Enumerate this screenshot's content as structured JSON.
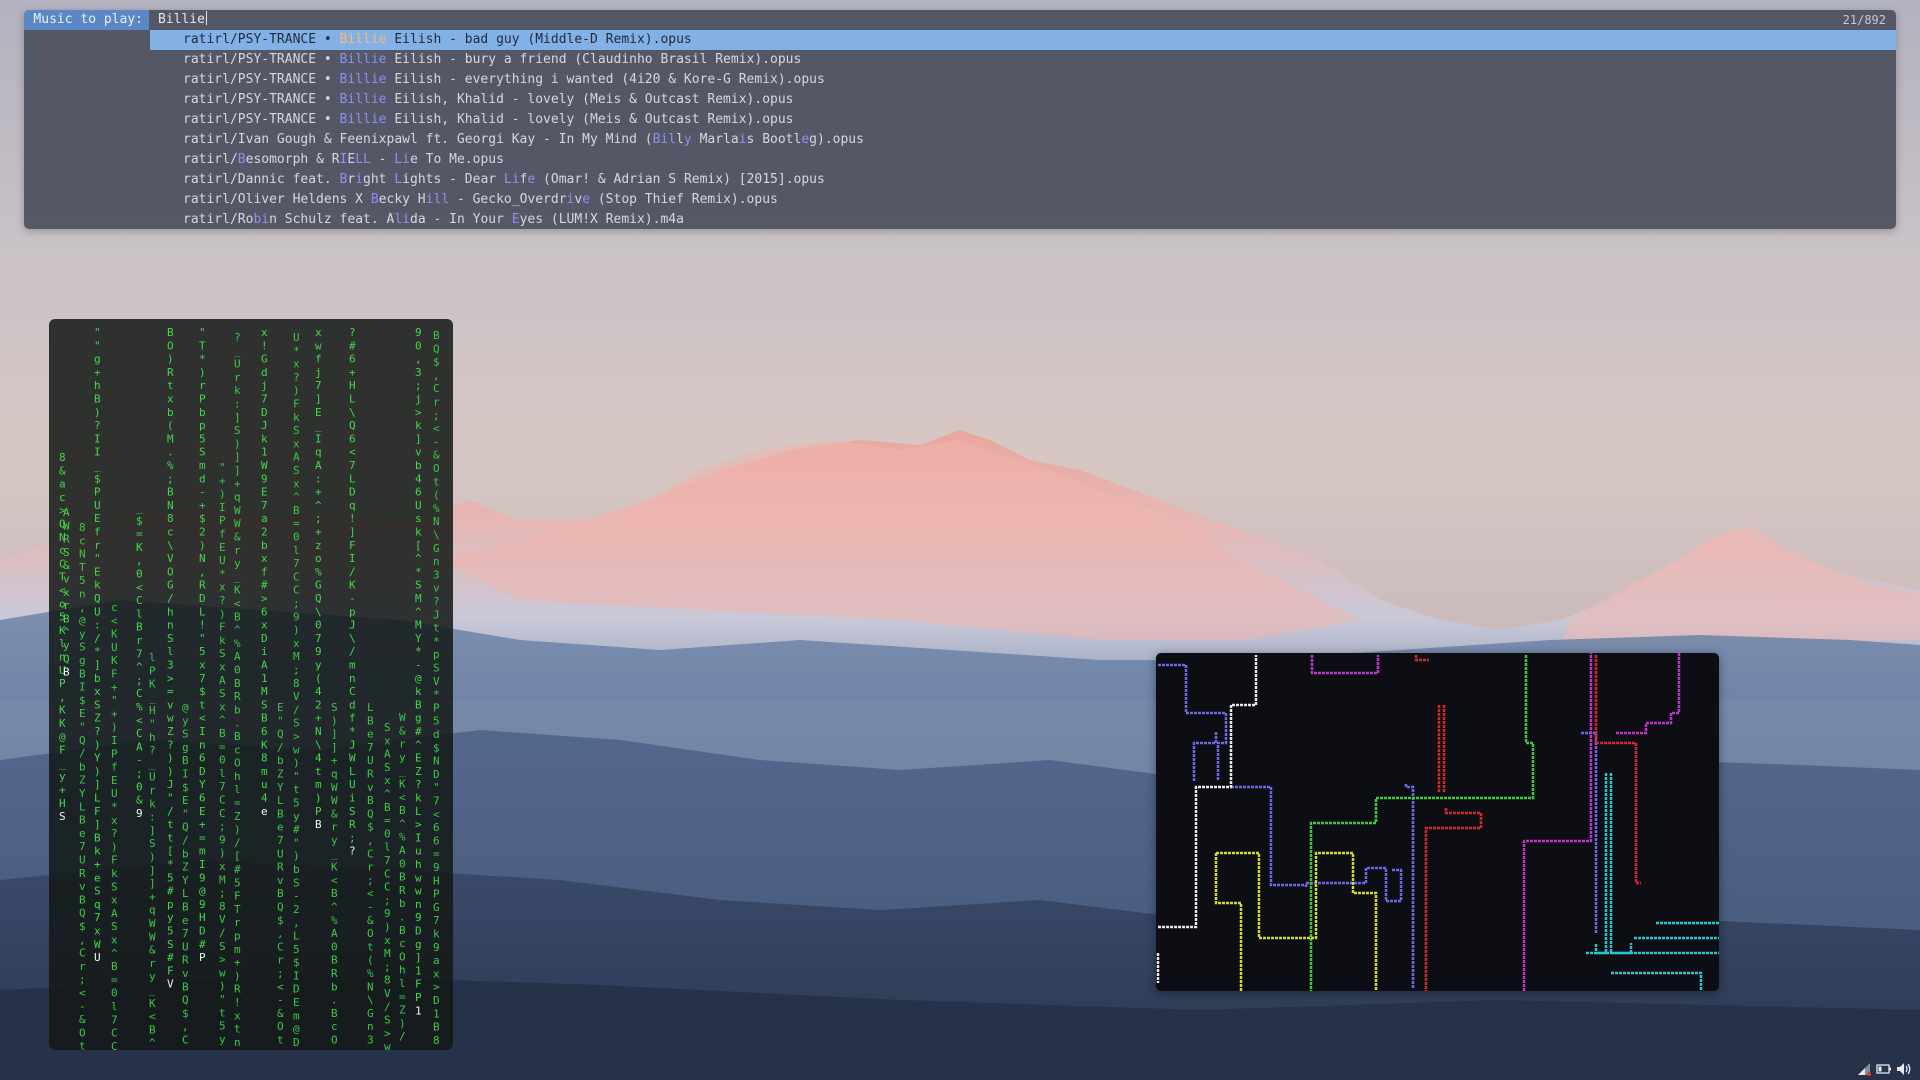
{
  "launcher": {
    "prompt_label": "Music to play:",
    "query": "Billie",
    "match_count": "21/892",
    "results": [
      {
        "segments": [
          [
            "ratirl/PSY-TRANCE • ",
            0
          ],
          [
            "Billie",
            1
          ],
          [
            " Eilish - bad guy (Middle-D Remix).opus",
            0
          ]
        ],
        "selected": true
      },
      {
        "segments": [
          [
            "ratirl/PSY-TRANCE • ",
            0
          ],
          [
            "Billie",
            1
          ],
          [
            " Eilish - bury a friend (Claudinho Brasil Remix).opus",
            0
          ]
        ]
      },
      {
        "segments": [
          [
            "ratirl/PSY-TRANCE • ",
            0
          ],
          [
            "Billie",
            1
          ],
          [
            " Eilish - everything i wanted (4i20 & Kore-G Remix).opus",
            0
          ]
        ]
      },
      {
        "segments": [
          [
            "ratirl/PSY-TRANCE • ",
            0
          ],
          [
            "Billie",
            1
          ],
          [
            " Eilish, Khalid - lovely (Meis & Outcast Remix).opus",
            0
          ]
        ]
      },
      {
        "segments": [
          [
            "ratirl/PSY-TRANCE • ",
            0
          ],
          [
            "Billie",
            1
          ],
          [
            " Eilish, Khalid - lovely (Meis & Outcast Remix).opus",
            0
          ]
        ]
      },
      {
        "segments": [
          [
            "ratirl/Ivan Gough & Feenixpawl ft. Georgi Kay - In My Mind (",
            0
          ],
          [
            "Bil",
            1
          ],
          [
            "l",
            0
          ],
          [
            "y",
            1
          ],
          [
            " Marla",
            0
          ],
          [
            "i",
            1
          ],
          [
            "s Bootl",
            0
          ],
          [
            "e",
            1
          ],
          [
            "g).opus",
            0
          ]
        ]
      },
      {
        "segments": [
          [
            "ratirl/",
            0
          ],
          [
            "B",
            1
          ],
          [
            "esomorph & R",
            0
          ],
          [
            "I",
            1
          ],
          [
            "E",
            0
          ],
          [
            "LL",
            1
          ],
          [
            " - ",
            0
          ],
          [
            "Li",
            1
          ],
          [
            "e To Me.opus",
            0
          ]
        ]
      },
      {
        "segments": [
          [
            "ratirl/Dannic feat. ",
            0
          ],
          [
            "B",
            1
          ],
          [
            "r",
            0
          ],
          [
            "i",
            1
          ],
          [
            "ght ",
            0
          ],
          [
            "L",
            1
          ],
          [
            "ights - Dear ",
            0
          ],
          [
            "Li",
            1
          ],
          [
            "f",
            0
          ],
          [
            "e",
            1
          ],
          [
            " (Omar! & Adrian S Remix) [2015].opus",
            0
          ]
        ]
      },
      {
        "segments": [
          [
            "ratirl/Oliver Heldens X ",
            0
          ],
          [
            "B",
            1
          ],
          [
            "ecky H",
            0
          ],
          [
            "i",
            1
          ],
          [
            "ll",
            1
          ],
          [
            " - Gecko_Overdr",
            0
          ],
          [
            "i",
            1
          ],
          [
            "v",
            0
          ],
          [
            "e",
            1
          ],
          [
            " (Stop Thief Remix).opus",
            0
          ]
        ]
      },
      {
        "segments": [
          [
            "ratirl/Ro",
            0
          ],
          [
            "bi",
            1
          ],
          [
            "n Schulz feat. A",
            0
          ],
          [
            "li",
            1
          ],
          [
            "da - In Your ",
            0
          ],
          [
            "E",
            1
          ],
          [
            "yes (LUM!X Remix).m4a",
            0
          ]
        ]
      }
    ]
  },
  "matrix": {
    "columns": [
      "8&ac>QNcCT<o5KlnUP,KK@F_y+HS",
      "\"\"g+hB)?II_$PUEfr\"EkQU:/*]bxSZ?)Y)]LF]Bk+eSq7xWU",
      "A WRS&vxrB^yQB",
      "_ $ = K , 0 < C l B r 7 ^ ; C % < C A - ; 0 & 9",
      "B O ) R t x b ( M . % ; B N 8 c \\ V O G / h n S l 3 > = v w Z ? ) ) J \" / t t [ * 5 # p y 5 S # F V",
      "\" T * ) r P b p 5 S m d - + $ 2 ) N , R D L ! \" 5 x 7 $ t < I n 6 D Y 6 E + = m I 9 @ 9 H D # P",
      "x ! G d j 7 D J k 1 W 9 E 7 a 2 b x f # > 6 x D i A 1 M S B 6 K 8 m u 4 e",
      "x w f j 7 ] E _ I q A : + ^ ; + z o % G Q \\ 0 7 9 y ( 4 2 + N \\ 4 t m ) P B",
      "? # 6 + H L \\ Q 6 < 7 L D q ! ] F I / K - p J \\ / m n C d f * J W L U i S R ; ?",
      "9 0 , 3 ; j > k ] v b 4 6 U s k [ ^ * S M ^ M Y * - @ k B g # ^ E Z ? k L > I u h w w n 9 D g ] 1 F P 1"
    ]
  },
  "tray": {
    "icons": [
      "network-icon",
      "battery-icon",
      "volume-icon"
    ]
  }
}
